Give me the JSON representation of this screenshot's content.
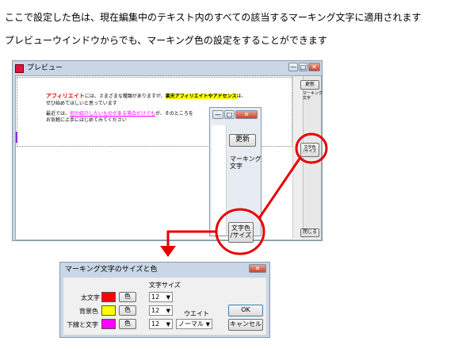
{
  "intro": {
    "line1": "ここで設定した色は、現在編集中のテキスト内のすべての該当するマーキング文字に適用されます",
    "line2": "プレビューウインドウからでも、マーキング色の設定をすることができます"
  },
  "preview_window": {
    "title": "プレビュー",
    "minimize": "—",
    "maximize": "□",
    "close": "✕",
    "sidebar": {
      "update_button": "更新",
      "marking_label": "マーキング\n文字",
      "char_color_button": "文字色\n/サイズ",
      "close_button": "閉じる"
    },
    "content": {
      "p1_bold": "アフィリエイト",
      "p1_mid": "には、さまざまな種類がありますが、",
      "p1_highlight": "楽天アフィリエイトやアドセンス",
      "p1_end": "は、",
      "p1_line2": "ぜひ始めてほしいと思っています",
      "p2_start": "最近では、",
      "p2_link": "何か紹介したいものがある場合だけでも",
      "p2_end": "が、そのところを",
      "p2_line2": "お気軽に上手にはじめてみてください"
    }
  },
  "zoom_panel": {
    "minimize": "—",
    "maximize": "□",
    "close": "✕",
    "update_button": "更新",
    "marking_label": "マーキング\n文字",
    "char_color_button": "文字色\n/サイズ"
  },
  "dialog": {
    "title": "マーキング文字のサイズと色",
    "close": "✕",
    "size_header": "文字サイズ",
    "weight_label": "ウエイト",
    "rows": [
      {
        "label": "太文字",
        "color": "#ff0000",
        "button": "色",
        "size": "12"
      },
      {
        "label": "背景色",
        "color": "#ffff00",
        "button": "色",
        "size": "12"
      },
      {
        "label": "下線と文字",
        "color": "#ff00ff",
        "button": "色",
        "size": "12"
      }
    ],
    "weight_value": "ノーマル",
    "ok_button": "OK",
    "cancel_button": "キャンセル"
  },
  "colors": {
    "annotation_red": "#e60000",
    "bold_text": "#e60000",
    "highlight": "#ffff00",
    "link": "#ff00ff"
  }
}
